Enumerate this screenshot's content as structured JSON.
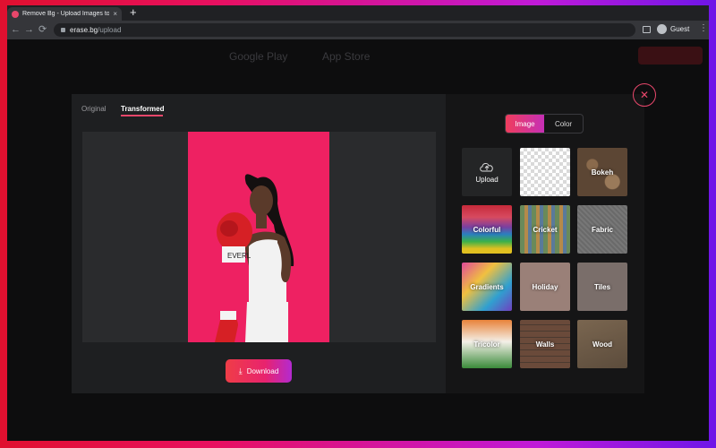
{
  "browser": {
    "tab_title": "Remove Bg - Upload Images to",
    "tab_close": "×",
    "new_tab": "+",
    "url_host": "erase.bg",
    "url_path": "/upload",
    "back": "←",
    "forward": "→",
    "reload": "⟳",
    "profile_label": "Guest",
    "menu": "⋮"
  },
  "background_page": {
    "nav_items": [
      "Google Play",
      "App Store"
    ]
  },
  "modal": {
    "tabs": [
      {
        "label": "Original",
        "active": false
      },
      {
        "label": "Transformed",
        "active": true
      }
    ],
    "close_symbol": "✕",
    "download_label": "Download",
    "photo_bg_color": "#ee2162",
    "mode_toggle": [
      {
        "label": "Image",
        "active": true
      },
      {
        "label": "Color",
        "active": false
      }
    ],
    "backgrounds": [
      {
        "label": "Upload"
      },
      {
        "label": ""
      },
      {
        "label": "Bokeh"
      },
      {
        "label": "Colorful"
      },
      {
        "label": "Cricket"
      },
      {
        "label": "Fabric"
      },
      {
        "label": "Gradients"
      },
      {
        "label": "Holiday"
      },
      {
        "label": "Tiles"
      },
      {
        "label": "Tricolor"
      },
      {
        "label": "Walls"
      },
      {
        "label": "Wood"
      }
    ]
  },
  "colors": {
    "accent": "#e8476b",
    "frame_gradient_start": "#e0102f",
    "frame_gradient_end": "#6e16e8"
  }
}
